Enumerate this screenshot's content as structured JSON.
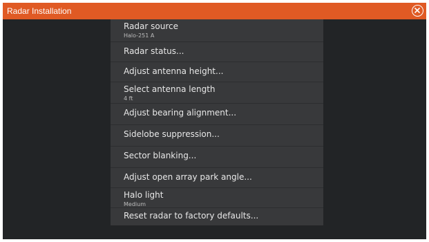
{
  "window": {
    "title": "Radar Installation",
    "close_icon": "close-circle-icon",
    "colors": {
      "titlebar": "#e05a24",
      "background": "#222426",
      "menu": "#38393b",
      "text": "#e8e8e8"
    }
  },
  "menu": {
    "items": [
      {
        "label": "Radar source",
        "sub": "Halo-251 A"
      },
      {
        "label": "Radar status..."
      },
      {
        "label": "Adjust antenna height..."
      },
      {
        "label": "Select antenna length",
        "sub": "4 ft"
      },
      {
        "label": "Adjust bearing alignment..."
      },
      {
        "label": "Sidelobe suppression..."
      },
      {
        "label": "Sector blanking..."
      },
      {
        "label": "Adjust open array park angle..."
      },
      {
        "label": "Halo light",
        "sub": "Medium"
      },
      {
        "label": "Reset radar to factory defaults..."
      }
    ]
  }
}
